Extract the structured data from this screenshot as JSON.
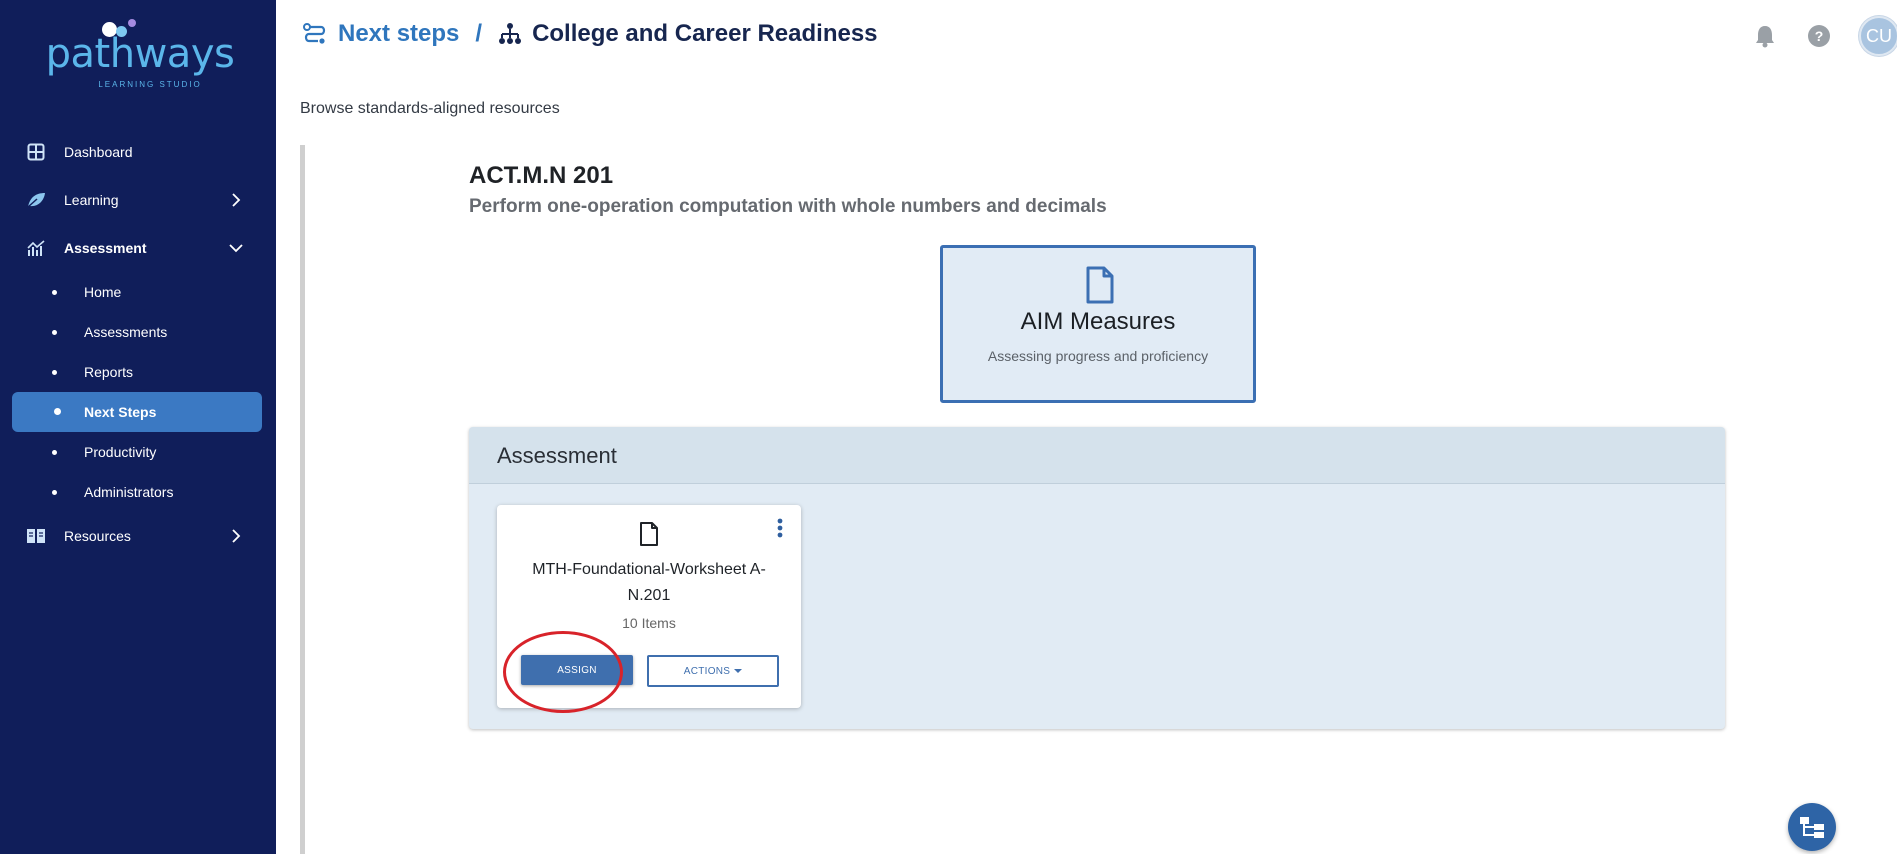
{
  "brand": {
    "name": "pathways",
    "tagline": "LEARNING STUDIO"
  },
  "sidebar": {
    "items": [
      {
        "label": "Dashboard",
        "icon": "grid-icon"
      },
      {
        "label": "Learning",
        "icon": "leaf-icon"
      },
      {
        "label": "Assessment",
        "icon": "chart-icon",
        "expanded": true
      },
      {
        "label": "Resources",
        "icon": "book-icon"
      }
    ],
    "assessment_sub": [
      {
        "label": "Home"
      },
      {
        "label": "Assessments"
      },
      {
        "label": "Reports"
      },
      {
        "label": "Next Steps",
        "active": true
      },
      {
        "label": "Productivity"
      },
      {
        "label": "Administrators"
      }
    ]
  },
  "header": {
    "crumb_link": "Next steps",
    "crumb_sep": "/",
    "crumb_title": "College and Career Readiness",
    "avatar_initials": "CU"
  },
  "page": {
    "subtitle": "Browse standards-aligned resources",
    "standard_code": "ACT.M.N 201",
    "standard_desc": "Perform one-operation computation with whole numbers and decimals"
  },
  "aim_card": {
    "title": "AIM Measures",
    "subtitle": "Assessing progress and proficiency"
  },
  "assessment": {
    "section_title": "Assessment",
    "resource": {
      "name": "MTH-Foundational-Worksheet A-N.201",
      "count": "10 Items",
      "assign_label": "ASSIGN",
      "actions_label": "ACTIONS"
    }
  },
  "colors": {
    "sidebar_bg": "#101e5a",
    "active_item": "#3b79c3",
    "accent": "#2f76bd",
    "highlight_ring": "#d8232a"
  }
}
